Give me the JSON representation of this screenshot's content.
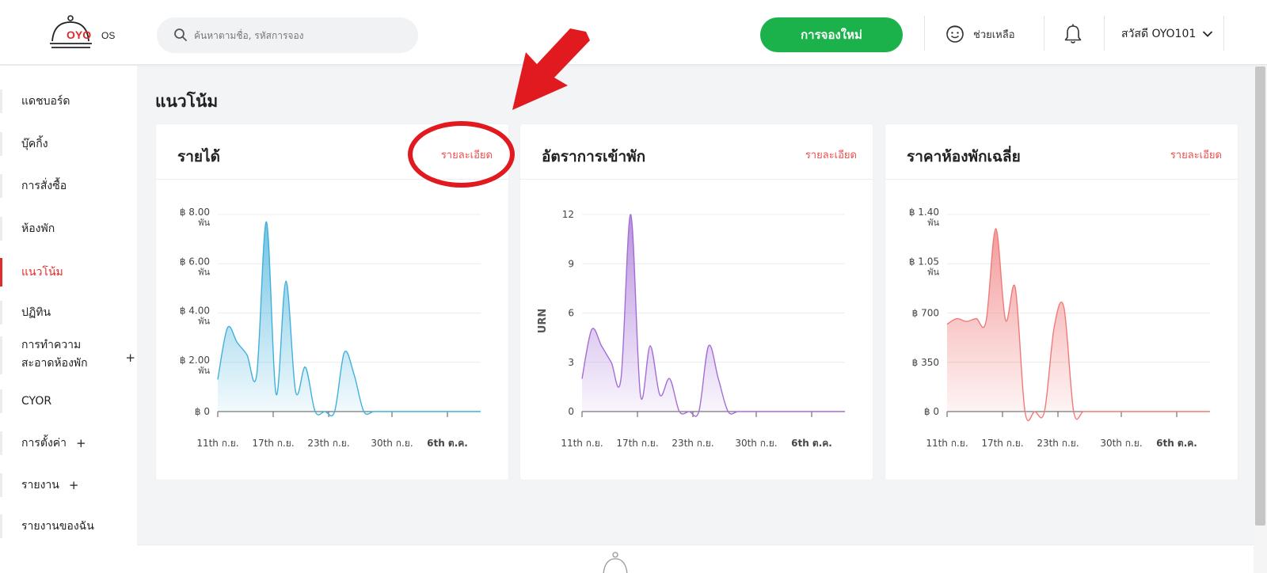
{
  "header": {
    "logo_text": "OYO",
    "logo_suffix": "OS",
    "search_placeholder": "ค้นหาตามชื่อ, รหัสการจอง",
    "new_booking_label": "การจองใหม่",
    "help_label": "ช่วยเหลือ",
    "user_greeting": "สวัสดี OYO101"
  },
  "sidebar": {
    "items": [
      {
        "label": "แดชบอร์ด"
      },
      {
        "label": "บุ๊คกิ้ง"
      },
      {
        "label": "การสั่งซื้อ"
      },
      {
        "label": "ห้องพัก"
      },
      {
        "label": "แนวโน้ม",
        "active": true
      },
      {
        "label": "ปฏิทิน"
      },
      {
        "label_line1": "การทำความ",
        "label_line2": "สะอาดห้องพัก",
        "plus": "+"
      },
      {
        "label": "CYOR"
      },
      {
        "label": "การตั้งค่า",
        "plus": "+"
      },
      {
        "label": "รายงาน",
        "plus": "+"
      },
      {
        "label": "รายงานของฉัน"
      }
    ]
  },
  "main": {
    "title": "แนวโน้ม"
  },
  "cards": [
    {
      "title": "รายได้",
      "detail_label": "รายละเอียด"
    },
    {
      "title": "อัตราการเข้าพัก",
      "detail_label": "รายละเอียด"
    },
    {
      "title": "ราคาห้องพักเฉลี่ย",
      "detail_label": "รายละเอียด"
    }
  ],
  "chart_data": [
    {
      "type": "area",
      "color": "#40b0dc",
      "x_labels": [
        "11th ก.ย.",
        "17th ก.ย.",
        "23th ก.ย.",
        "30th ก.ย.",
        "6th ต.ค."
      ],
      "y_ticks": [
        {
          "value": 0,
          "label": "฿ 0",
          "sub": ""
        },
        {
          "value": 2000,
          "label": "฿ 2.00",
          "sub": "พัน"
        },
        {
          "value": 4000,
          "label": "฿ 4.00",
          "sub": "พัน"
        },
        {
          "value": 6000,
          "label": "฿ 6.00",
          "sub": "พัน"
        },
        {
          "value": 8000,
          "label": "฿ 8.00",
          "sub": "พัน"
        }
      ],
      "ylabel": "",
      "ylim": [
        0,
        8000
      ],
      "x": [
        0,
        1,
        2,
        3,
        4,
        5,
        6,
        7,
        8,
        9,
        10,
        11,
        12,
        13,
        14,
        15,
        16,
        17,
        18,
        19,
        20,
        21,
        22,
        23,
        24,
        25,
        26,
        27
      ],
      "values": [
        1300,
        3400,
        2800,
        2300,
        1500,
        7700,
        700,
        5300,
        800,
        1800,
        0,
        0,
        0,
        2400,
        1500,
        0,
        0,
        0,
        0,
        0,
        0,
        0,
        0,
        0,
        0,
        0,
        0,
        0
      ]
    },
    {
      "type": "area",
      "color": "#a36ed6",
      "x_labels": [
        "11th ก.ย.",
        "17th ก.ย.",
        "23th ก.ย.",
        "30th ก.ย.",
        "6th ต.ค."
      ],
      "y_ticks": [
        {
          "value": 0,
          "label": "0",
          "sub": ""
        },
        {
          "value": 3,
          "label": "3",
          "sub": ""
        },
        {
          "value": 6,
          "label": "6",
          "sub": ""
        },
        {
          "value": 9,
          "label": "9",
          "sub": ""
        },
        {
          "value": 12,
          "label": "12",
          "sub": ""
        }
      ],
      "ylabel": "URN",
      "ylim": [
        0,
        12
      ],
      "x": [
        0,
        1,
        2,
        3,
        4,
        5,
        6,
        7,
        8,
        9,
        10,
        11,
        12,
        13,
        14,
        15,
        16,
        17,
        18,
        19,
        20,
        21,
        22,
        23,
        24,
        25,
        26,
        27
      ],
      "values": [
        2,
        5,
        4,
        3,
        2,
        12,
        1,
        4,
        1,
        2,
        0,
        0,
        0,
        4,
        2,
        0,
        0,
        0,
        0,
        0,
        0,
        0,
        0,
        0,
        0,
        0,
        0,
        0
      ]
    },
    {
      "type": "area",
      "color": "#f07a7a",
      "x_labels": [
        "11th ก.ย.",
        "17th ก.ย.",
        "23th ก.ย.",
        "30th ก.ย.",
        "6th ต.ค."
      ],
      "y_ticks": [
        {
          "value": 0,
          "label": "฿ 0",
          "sub": ""
        },
        {
          "value": 350,
          "label": "฿ 350",
          "sub": ""
        },
        {
          "value": 700,
          "label": "฿ 700",
          "sub": ""
        },
        {
          "value": 1050,
          "label": "฿ 1.05",
          "sub": "พัน"
        },
        {
          "value": 1400,
          "label": "฿ 1.40",
          "sub": "พัน"
        }
      ],
      "ylabel": "",
      "ylim": [
        0,
        1400
      ],
      "x": [
        0,
        1,
        2,
        3,
        4,
        5,
        6,
        7,
        8,
        9,
        10,
        11,
        12,
        13,
        14,
        15,
        16,
        17,
        18,
        19,
        20,
        21,
        22,
        23,
        24,
        25,
        26,
        27
      ],
      "values": [
        620,
        660,
        640,
        660,
        640,
        1300,
        650,
        880,
        0,
        0,
        0,
        600,
        740,
        0,
        0,
        0,
        0,
        0,
        0,
        0,
        0,
        0,
        0,
        0,
        0,
        0,
        0,
        0
      ]
    }
  ]
}
